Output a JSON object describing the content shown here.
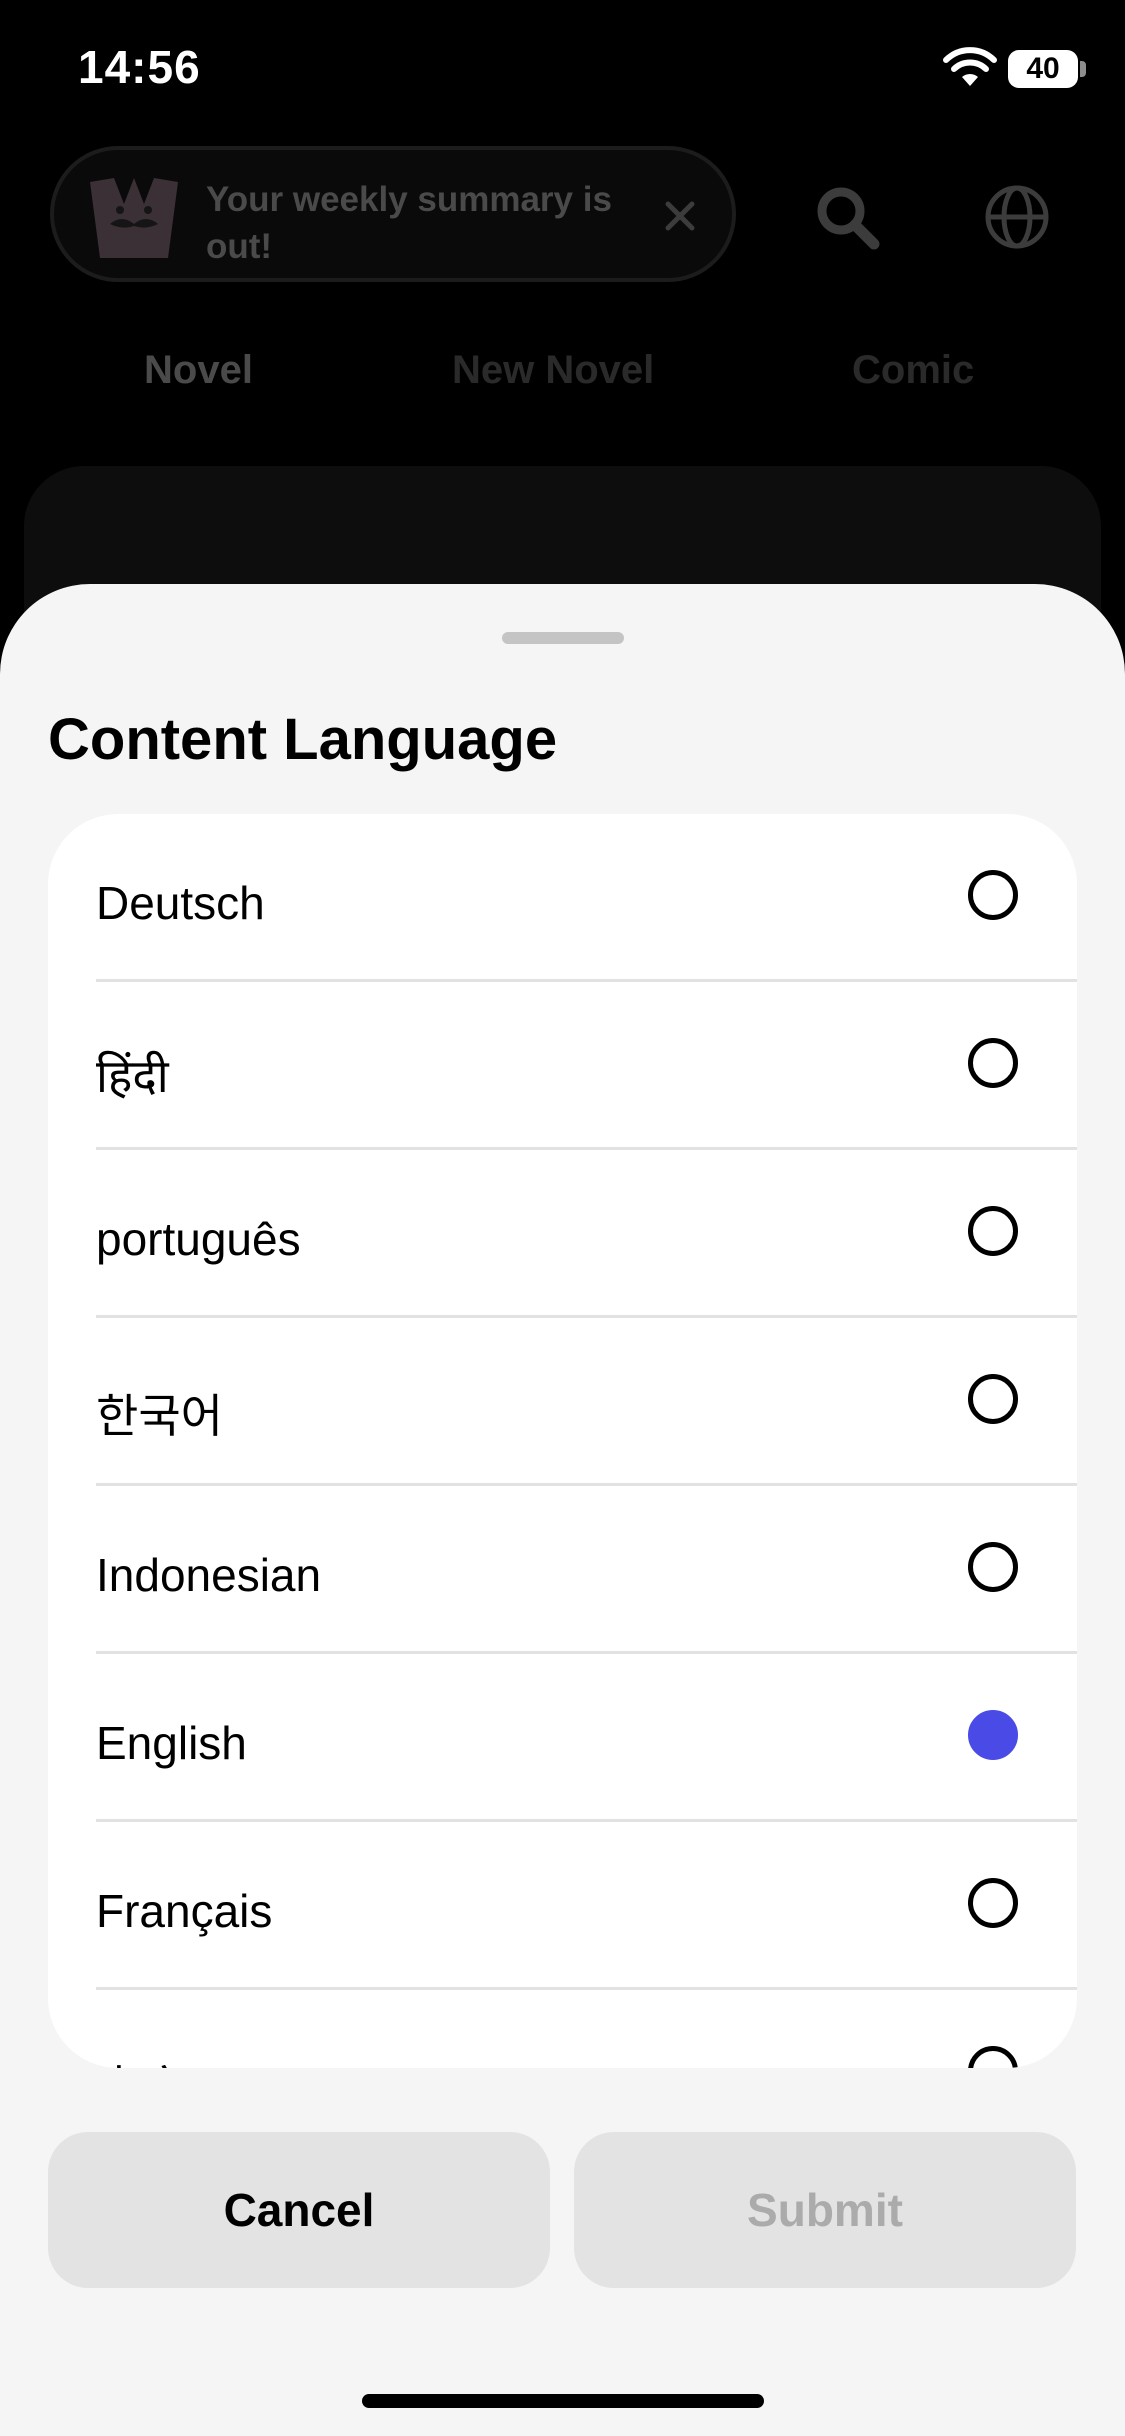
{
  "status_bar": {
    "time": "14:56",
    "battery": "40"
  },
  "background": {
    "notice_text": "Your weekly summary is out!",
    "tabs": [
      "Novel",
      "New Novel",
      "Comic"
    ]
  },
  "sheet": {
    "title": "Content Language",
    "languages": [
      {
        "label": "Deutsch",
        "selected": false
      },
      {
        "label": "हिंदी",
        "selected": false
      },
      {
        "label": "português",
        "selected": false
      },
      {
        "label": "한국어",
        "selected": false
      },
      {
        "label": "Indonesian",
        "selected": false
      },
      {
        "label": "English",
        "selected": true
      },
      {
        "label": "Français",
        "selected": false
      },
      {
        "label": "中文",
        "selected": false
      }
    ],
    "cancel_label": "Cancel",
    "submit_label": "Submit"
  },
  "colors": {
    "accent": "#4a4ae6",
    "sheet_bg": "#f5f5f5",
    "button_bg": "#e3e3e3",
    "disabled_text": "#ababab"
  }
}
